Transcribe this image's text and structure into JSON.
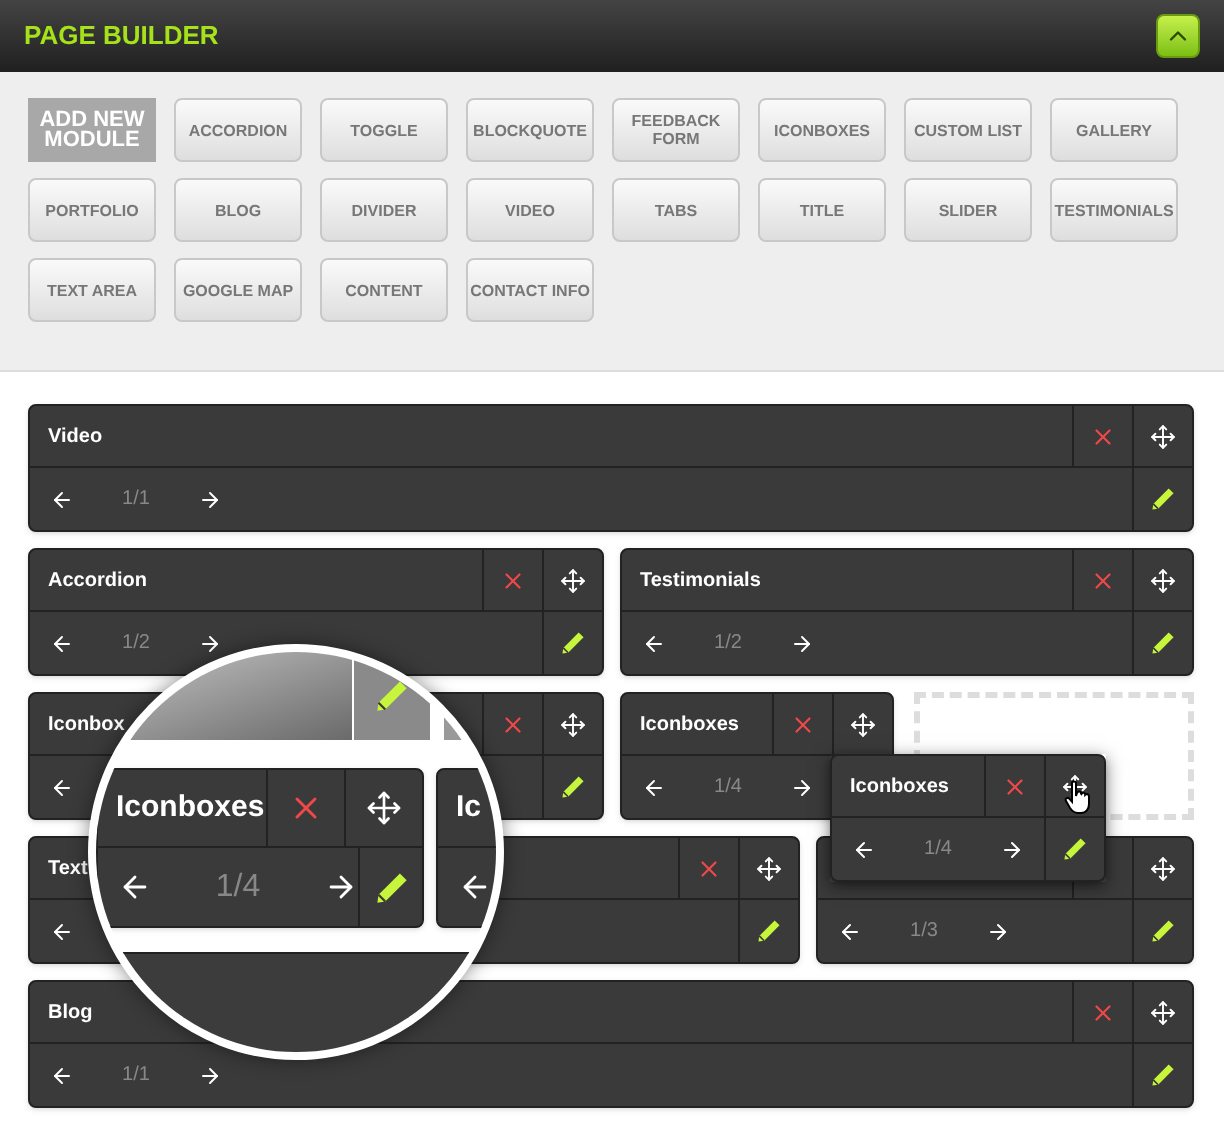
{
  "header": {
    "title": "PAGE BUILDER",
    "collapsed": false
  },
  "palette": [
    {
      "label": "ADD NEW MODULE",
      "kind": "heading"
    },
    {
      "label": "ACCORDION",
      "kind": "button"
    },
    {
      "label": "TOGGLE",
      "kind": "button"
    },
    {
      "label": "BLOCKQUOTE",
      "kind": "button"
    },
    {
      "label": "FEEDBACK FORM",
      "kind": "button"
    },
    {
      "label": "ICONBOXES",
      "kind": "button"
    },
    {
      "label": "CUSTOM LIST",
      "kind": "button"
    },
    {
      "label": "GALLERY",
      "kind": "button"
    },
    {
      "label": "PORTFOLIO",
      "kind": "button"
    },
    {
      "label": "BLOG",
      "kind": "button"
    },
    {
      "label": "DIVIDER",
      "kind": "button"
    },
    {
      "label": "VIDEO",
      "kind": "button"
    },
    {
      "label": "TABS",
      "kind": "button"
    },
    {
      "label": "TITLE",
      "kind": "button"
    },
    {
      "label": "SLIDER",
      "kind": "button"
    },
    {
      "label": "TESTIMONIALS",
      "kind": "button"
    },
    {
      "label": "TEXT AREA",
      "kind": "button"
    },
    {
      "label": "GOOGLE MAP",
      "kind": "button"
    },
    {
      "label": "CONTENT",
      "kind": "button"
    },
    {
      "label": "CONTACT INFO",
      "kind": "button"
    }
  ],
  "rows": [
    {
      "modules": [
        {
          "kind": "module",
          "title": "Video",
          "page": "1/1"
        }
      ]
    },
    {
      "modules": [
        {
          "kind": "module",
          "title": "Accordion",
          "page": "1/2"
        },
        {
          "kind": "module",
          "title": "Testimonials",
          "page": "1/2"
        }
      ]
    },
    {
      "modules": [
        {
          "kind": "module",
          "title": "Iconbox"
        },
        {
          "kind": "module",
          "title": "Iconboxes",
          "page": "1/4"
        },
        {
          "kind": "placeholder"
        }
      ]
    },
    {
      "modules": [
        {
          "kind": "module",
          "title": "Text"
        },
        {
          "kind": "module",
          "page": "1/3",
          "close_covered": true
        }
      ]
    },
    {
      "modules": [
        {
          "kind": "module",
          "title": "Blog",
          "page": "1/1"
        }
      ]
    }
  ],
  "dragged": {
    "title": "Iconboxes",
    "page": "1/4"
  },
  "magnifier": {
    "modules": [
      {
        "title": "Iconboxes",
        "page": "1/4"
      },
      {
        "title": "Ic"
      }
    ]
  }
}
